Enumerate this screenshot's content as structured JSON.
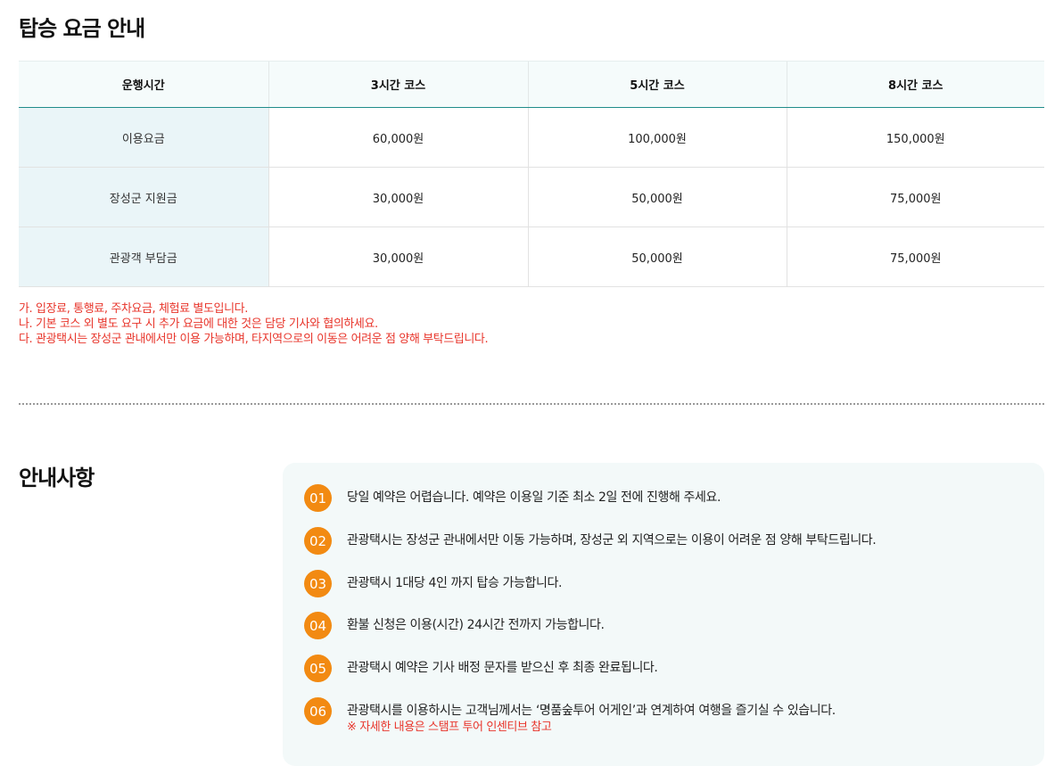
{
  "fare_section": {
    "title": "탑승 요금 안내",
    "headers": [
      "운행시간",
      "3시간 코스",
      "5시간 코스",
      "8시간 코스"
    ],
    "rows": [
      {
        "label": "이용요금",
        "values": [
          "60,000원",
          "100,000원",
          "150,000원"
        ]
      },
      {
        "label": "장성군 지원금",
        "values": [
          "30,000원",
          "50,000원",
          "75,000원"
        ]
      },
      {
        "label": "관광객 부담금",
        "values": [
          "30,000원",
          "50,000원",
          "75,000원"
        ]
      }
    ],
    "notes": [
      "가. 입장료, 통행료, 주차요금, 체험료 별도입니다.",
      "나. 기본 코스 외 별도 요구 시 추가 요금에 대한 것은 담당 기사와 협의하세요.",
      "다. 관광택시는 장성군 관내에서만 이용 가능하며, 타지역으로의 이동은 어려운 점 양해 부탁드립니다."
    ]
  },
  "info_section": {
    "title": "안내사항",
    "items": [
      {
        "num": "01",
        "text": "당일 예약은 어렵습니다. 예약은 이용일 기준 최소 2일 전에 진행해 주세요."
      },
      {
        "num": "02",
        "text": "관광택시는 장성군 관내에서만 이동 가능하며, 장성군 외 지역으로는 이용이 어려운 점 양해 부탁드립니다."
      },
      {
        "num": "03",
        "text": "관광택시 1대당 4인 까지 탑승 가능합니다."
      },
      {
        "num": "04",
        "text": "환불 신청은 이용(시간) 24시간 전까지 가능합니다."
      },
      {
        "num": "05",
        "text": "관광택시 예약은 기사 배정 문자를 받으신 후 최종 완료됩니다."
      },
      {
        "num": "06",
        "text": "관광택시를 이용하시는 고객님께서는 ‘명품숲투어 어게인’과 연계하여 여행을 즐기실 수 있습니다.",
        "sub": "※ 자세한 내용은 스탬프 투어 인센티브 참고"
      }
    ]
  },
  "colors": {
    "accent_orange": "#f28a12",
    "note_red": "#e8352b",
    "teal_line": "#1f8c8a",
    "label_cell_bg": "#eaf5f8",
    "info_bg": "#f3f9f9"
  }
}
